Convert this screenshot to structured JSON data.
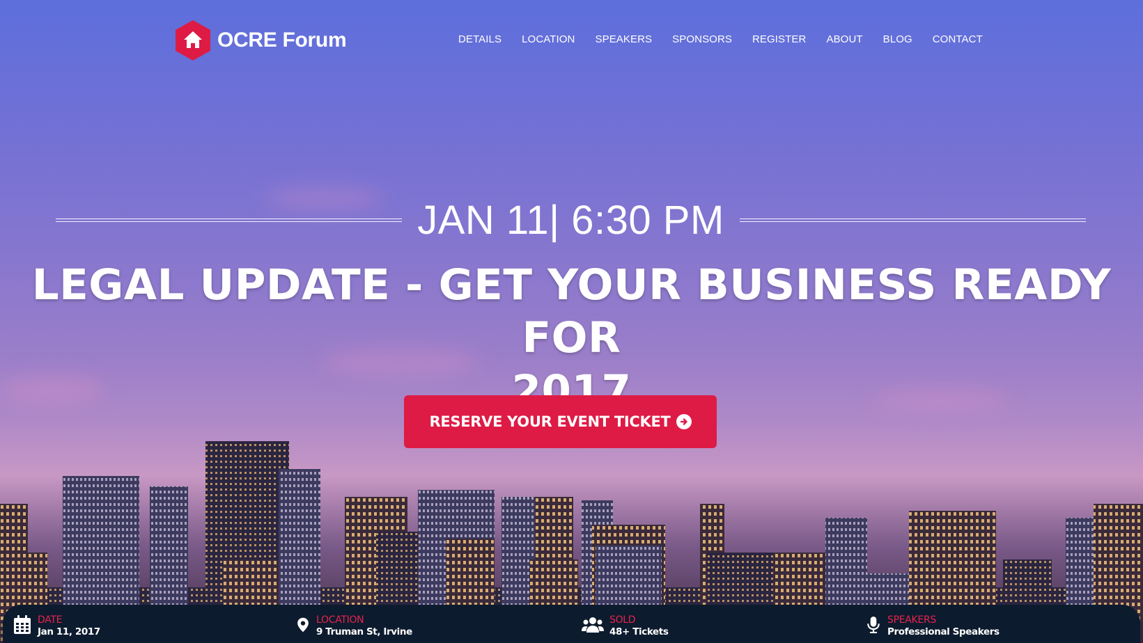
{
  "header": {
    "logo_text": "OCRE Forum",
    "logo_icon": "home-icon",
    "nav": [
      "DETAILS",
      "LOCATION",
      "SPEAKERS",
      "SPONSORS",
      "REGISTER",
      "ABOUT",
      "BLOG",
      "CONTACT"
    ]
  },
  "hero": {
    "date_time": "JAN 11| 6:30 PM",
    "headline_line1": "LEGAL UPDATE - GET YOUR BUSINESS READY FOR",
    "headline_line2": "2017",
    "cta_label": "RESERVE YOUR EVENT TICKET",
    "cta_icon": "arrow-circle-right-icon"
  },
  "info_bar": {
    "date": {
      "label": "DATE",
      "value": "Jan 11, 2017",
      "icon": "calendar-icon"
    },
    "location": {
      "label": "LOCATION",
      "value": "9 Truman St, Irvine",
      "icon": "map-pin-icon"
    },
    "sold": {
      "label": "SOLD",
      "value": "48+ Tickets",
      "icon": "users-icon"
    },
    "speakers": {
      "label": "SPEAKERS",
      "value": "Professional Speakers",
      "icon": "microphone-icon"
    }
  },
  "colors": {
    "accent": "#de1b45",
    "bar_bg": "#0d1b2e",
    "label_red": "#e8234e"
  }
}
